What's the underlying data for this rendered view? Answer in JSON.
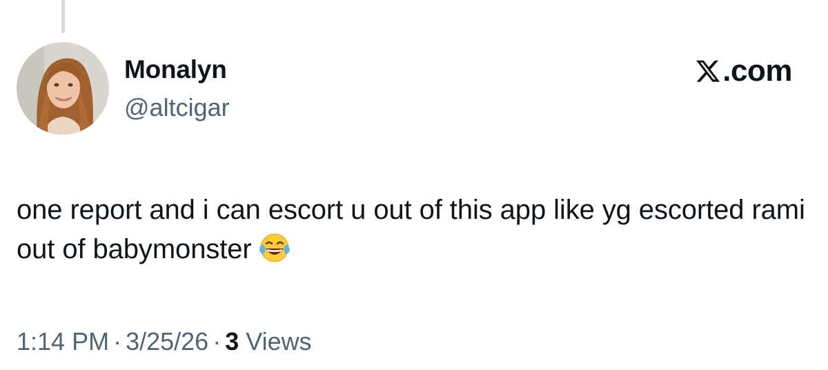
{
  "author": {
    "display_name": "Monalyn",
    "handle": "@altcigar",
    "avatar_icon": "user-avatar-photo"
  },
  "brand": {
    "logo_icon": "x-logo-icon",
    "domain_suffix": ".com"
  },
  "tweet": {
    "text": "one report and i can escort u out of this app like yg escorted rami out of babymonster",
    "emoji_icon": "face-with-tears-of-joy-icon"
  },
  "meta": {
    "time": "1:14 PM",
    "separator": "·",
    "date": "3/25/26",
    "views_count": "3",
    "views_label": "Views"
  },
  "colors": {
    "text_primary": "#0f1419",
    "text_secondary": "#536471",
    "thread_line": "#cfd9de",
    "background": "#ffffff"
  }
}
